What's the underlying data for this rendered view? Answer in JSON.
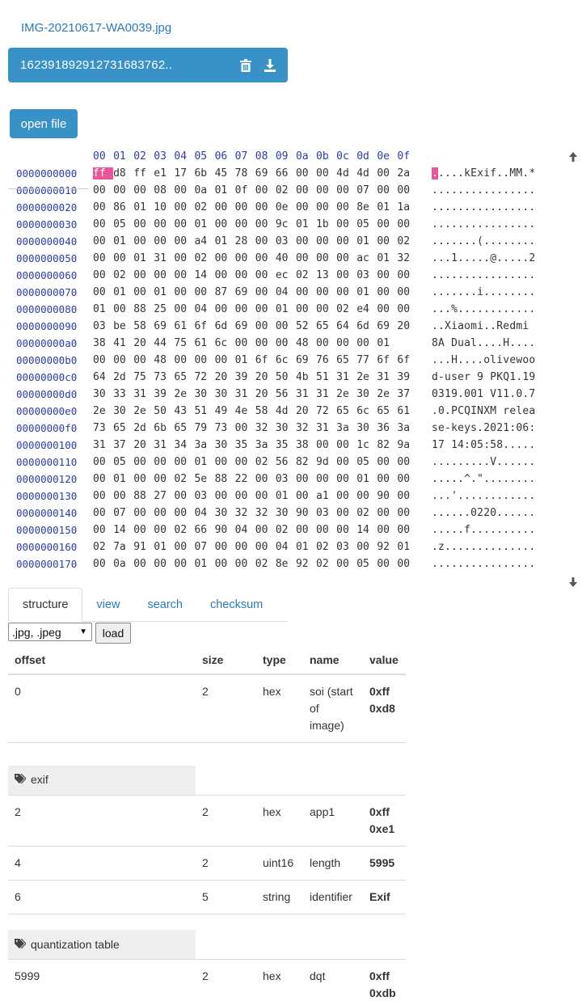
{
  "file": {
    "name_link": "IMG-20210617-WA0039.jpg",
    "bar_name": "162391892912731683762..",
    "delete_icon": "trash-icon",
    "download_icon": "download-icon"
  },
  "open_button": "open file",
  "hex": {
    "columns": [
      "00",
      "01",
      "02",
      "03",
      "04",
      "05",
      "06",
      "07",
      "08",
      "09",
      "0a",
      "0b",
      "0c",
      "0d",
      "0e",
      "0f"
    ],
    "rows": [
      {
        "offset": "0000000000",
        "bytes": [
          "ff",
          "d8",
          "ff",
          "e1",
          "17",
          "6b",
          "45",
          "78",
          "69",
          "66",
          "00",
          "00",
          "4d",
          "4d",
          "00",
          "2a"
        ],
        "ascii": "....kExif..MM.*"
      },
      {
        "offset": "0000000010",
        "bytes": [
          "00",
          "00",
          "00",
          "08",
          "00",
          "0a",
          "01",
          "0f",
          "00",
          "02",
          "00",
          "00",
          "00",
          "07",
          "00",
          "00"
        ],
        "ascii": "................"
      },
      {
        "offset": "0000000020",
        "bytes": [
          "00",
          "86",
          "01",
          "10",
          "00",
          "02",
          "00",
          "00",
          "00",
          "0e",
          "00",
          "00",
          "00",
          "8e",
          "01",
          "1a"
        ],
        "ascii": "................"
      },
      {
        "offset": "0000000030",
        "bytes": [
          "00",
          "05",
          "00",
          "00",
          "00",
          "01",
          "00",
          "00",
          "00",
          "9c",
          "01",
          "1b",
          "00",
          "05",
          "00",
          "00"
        ],
        "ascii": "................"
      },
      {
        "offset": "0000000040",
        "bytes": [
          "00",
          "01",
          "00",
          "00",
          "00",
          "a4",
          "01",
          "28",
          "00",
          "03",
          "00",
          "00",
          "00",
          "01",
          "00",
          "02"
        ],
        "ascii": ".......(........"
      },
      {
        "offset": "0000000050",
        "bytes": [
          "00",
          "00",
          "01",
          "31",
          "00",
          "02",
          "00",
          "00",
          "00",
          "40",
          "00",
          "00",
          "00",
          "ac",
          "01",
          "32"
        ],
        "ascii": "...1.....@.....2"
      },
      {
        "offset": "0000000060",
        "bytes": [
          "00",
          "02",
          "00",
          "00",
          "00",
          "14",
          "00",
          "00",
          "00",
          "ec",
          "02",
          "13",
          "00",
          "03",
          "00",
          "00"
        ],
        "ascii": "................"
      },
      {
        "offset": "0000000070",
        "bytes": [
          "00",
          "01",
          "00",
          "01",
          "00",
          "00",
          "87",
          "69",
          "00",
          "04",
          "00",
          "00",
          "00",
          "01",
          "00",
          "00"
        ],
        "ascii": ".......i........"
      },
      {
        "offset": "0000000080",
        "bytes": [
          "01",
          "00",
          "88",
          "25",
          "00",
          "04",
          "00",
          "00",
          "00",
          "01",
          "00",
          "00",
          "02",
          "e4",
          "00",
          "00"
        ],
        "ascii": "...%............"
      },
      {
        "offset": "0000000090",
        "bytes": [
          "03",
          "be",
          "58",
          "69",
          "61",
          "6f",
          "6d",
          "69",
          "00",
          "00",
          "52",
          "65",
          "64",
          "6d",
          "69",
          "20"
        ],
        "ascii": "..Xiaomi..Redmi "
      },
      {
        "offset": "00000000a0",
        "bytes": [
          "38",
          "41",
          "20",
          "44",
          "75",
          "61",
          "6c",
          "00",
          "00",
          "00",
          "48",
          "00",
          "00",
          "00",
          "01"
        ],
        "ascii": "8A Dual....H...."
      },
      {
        "offset": "00000000b0",
        "bytes": [
          "00",
          "00",
          "00",
          "48",
          "00",
          "00",
          "00",
          "01",
          "6f",
          "6c",
          "69",
          "76",
          "65",
          "77",
          "6f",
          "6f"
        ],
        "ascii": "...H....olivewoo"
      },
      {
        "offset": "00000000c0",
        "bytes": [
          "64",
          "2d",
          "75",
          "73",
          "65",
          "72",
          "20",
          "39",
          "20",
          "50",
          "4b",
          "51",
          "31",
          "2e",
          "31",
          "39"
        ],
        "ascii": "d-user 9 PKQ1.19"
      },
      {
        "offset": "00000000d0",
        "bytes": [
          "30",
          "33",
          "31",
          "39",
          "2e",
          "30",
          "30",
          "31",
          "20",
          "56",
          "31",
          "31",
          "2e",
          "30",
          "2e",
          "37"
        ],
        "ascii": "0319.001 V11.0.7"
      },
      {
        "offset": "00000000e0",
        "bytes": [
          "2e",
          "30",
          "2e",
          "50",
          "43",
          "51",
          "49",
          "4e",
          "58",
          "4d",
          "20",
          "72",
          "65",
          "6c",
          "65",
          "61"
        ],
        "ascii": ".0.PCQINXM relea"
      },
      {
        "offset": "00000000f0",
        "bytes": [
          "73",
          "65",
          "2d",
          "6b",
          "65",
          "79",
          "73",
          "00",
          "32",
          "30",
          "32",
          "31",
          "3a",
          "30",
          "36",
          "3a"
        ],
        "ascii": "se-keys.2021:06:"
      },
      {
        "offset": "0000000100",
        "bytes": [
          "31",
          "37",
          "20",
          "31",
          "34",
          "3a",
          "30",
          "35",
          "3a",
          "35",
          "38",
          "00",
          "00",
          "1c",
          "82",
          "9a"
        ],
        "ascii": "17 14:05:58....."
      },
      {
        "offset": "0000000110",
        "bytes": [
          "00",
          "05",
          "00",
          "00",
          "00",
          "01",
          "00",
          "00",
          "02",
          "56",
          "82",
          "9d",
          "00",
          "05",
          "00",
          "00"
        ],
        "ascii": ".........V......"
      },
      {
        "offset": "0000000120",
        "bytes": [
          "00",
          "01",
          "00",
          "00",
          "02",
          "5e",
          "88",
          "22",
          "00",
          "03",
          "00",
          "00",
          "00",
          "01",
          "00",
          "00"
        ],
        "ascii": ".....^.\"........"
      },
      {
        "offset": "0000000130",
        "bytes": [
          "00",
          "00",
          "88",
          "27",
          "00",
          "03",
          "00",
          "00",
          "00",
          "01",
          "00",
          "a1",
          "00",
          "00",
          "90",
          "00"
        ],
        "ascii": "...'............"
      },
      {
        "offset": "0000000140",
        "bytes": [
          "00",
          "07",
          "00",
          "00",
          "00",
          "04",
          "30",
          "32",
          "32",
          "30",
          "90",
          "03",
          "00",
          "02",
          "00",
          "00"
        ],
        "ascii": "......0220......"
      },
      {
        "offset": "0000000150",
        "bytes": [
          "00",
          "14",
          "00",
          "00",
          "02",
          "66",
          "90",
          "04",
          "00",
          "02",
          "00",
          "00",
          "00",
          "14",
          "00",
          "00"
        ],
        "ascii": ".....f.........."
      },
      {
        "offset": "0000000160",
        "bytes": [
          "02",
          "7a",
          "91",
          "01",
          "00",
          "07",
          "00",
          "00",
          "00",
          "04",
          "01",
          "02",
          "03",
          "00",
          "92",
          "01"
        ],
        "ascii": ".z.............."
      },
      {
        "offset": "0000000170",
        "bytes": [
          "00",
          "0a",
          "00",
          "00",
          "00",
          "01",
          "00",
          "00",
          "02",
          "8e",
          "92",
          "02",
          "00",
          "05",
          "00",
          "00"
        ],
        "ascii": "................"
      }
    ]
  },
  "tabs": [
    "structure",
    "view",
    "search",
    "checksum"
  ],
  "format_select": ".jpg, .jpeg",
  "load_button": "load",
  "table": {
    "headers": [
      "offset",
      "size",
      "type",
      "name",
      "value"
    ],
    "soi": {
      "offset": "0",
      "size": "2",
      "type": "hex",
      "name": "soi (start of image)",
      "value1": "0xff",
      "value2": "0xd8"
    },
    "group_exif": "exif",
    "app1": {
      "offset": "2",
      "size": "2",
      "type": "hex",
      "name": "app1",
      "value1": "0xff",
      "value2": "0xe1"
    },
    "length": {
      "offset": "4",
      "size": "2",
      "type": "uint16",
      "name": "length",
      "value": "5995"
    },
    "identifier": {
      "offset": "6",
      "size": "5",
      "type": "string",
      "name": "identifier",
      "value": "Exif"
    },
    "group_qt": "quantization table",
    "dqt": {
      "offset": "5999",
      "size": "2",
      "type": "hex",
      "name": "dqt",
      "value1": "0xff",
      "value2": "0xdb"
    }
  }
}
